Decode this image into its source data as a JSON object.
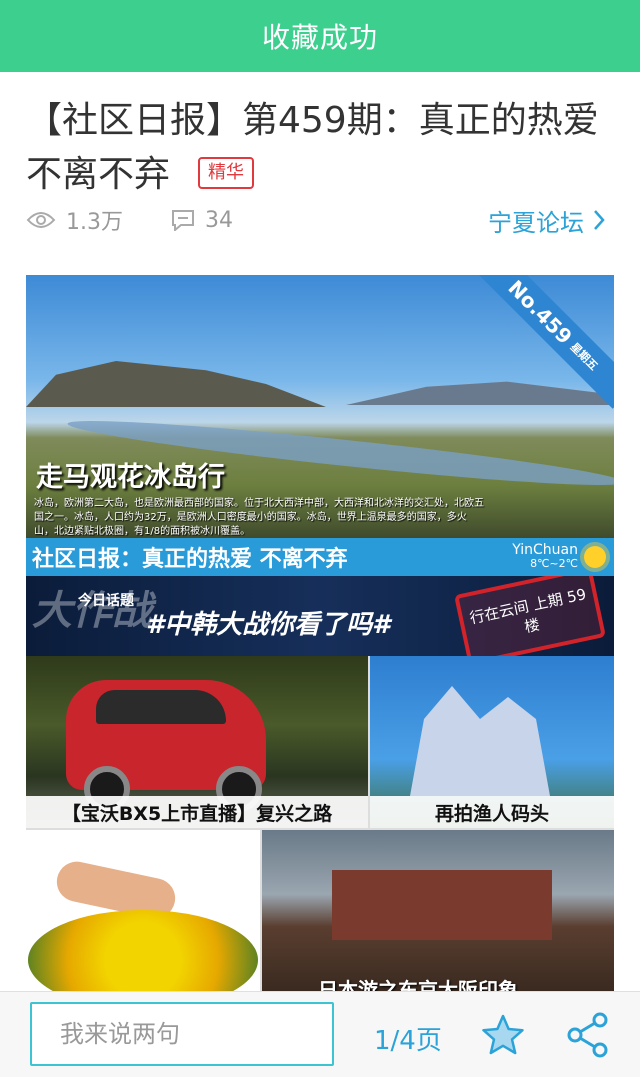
{
  "toast": {
    "text": "收藏成功"
  },
  "article": {
    "title": "【社区日报】第459期：真正的热爱不离不弃",
    "badge": "精华",
    "views": "1.3万",
    "comments": "34",
    "forum": "宁夏论坛"
  },
  "poster": {
    "ribbon_no": "No.459",
    "ribbon_day": "星期五",
    "hero_title": "走马观花冰岛行",
    "hero_desc": "冰岛，欧洲第二大岛，也是欧洲最西部的国家。位于北大西洋中部，大西洋和北冰洋的交汇处，北欧五国之一。冰岛，人口约为32万，是欧洲人口密度最小的国家。冰岛，世界上温泉最多的国家，多火山，北边紧贴北极圈，有1/8的面积被冰川覆盖。",
    "band_title": "社区日报：真正的热爱 不离不弃",
    "weather_city": "YinChuan",
    "weather_temp": "8℃~2℃",
    "topic_bg": "大作战",
    "topic_tag": "今日话题",
    "topic_main": "#中韩大战你看了吗#",
    "stamp_text": "行在云间 上期 59楼",
    "car_caption": "【宝沃BX5上市直播】复兴之路",
    "house_caption": "再拍渔人码头",
    "build_caption": "日本游之东京大阪印象"
  },
  "bottom": {
    "input_placeholder": "我来说两句",
    "page": "1/4页"
  },
  "colors": {
    "accent": "#3ccf8e",
    "link": "#2ba3d8",
    "badge": "#e0393e"
  }
}
